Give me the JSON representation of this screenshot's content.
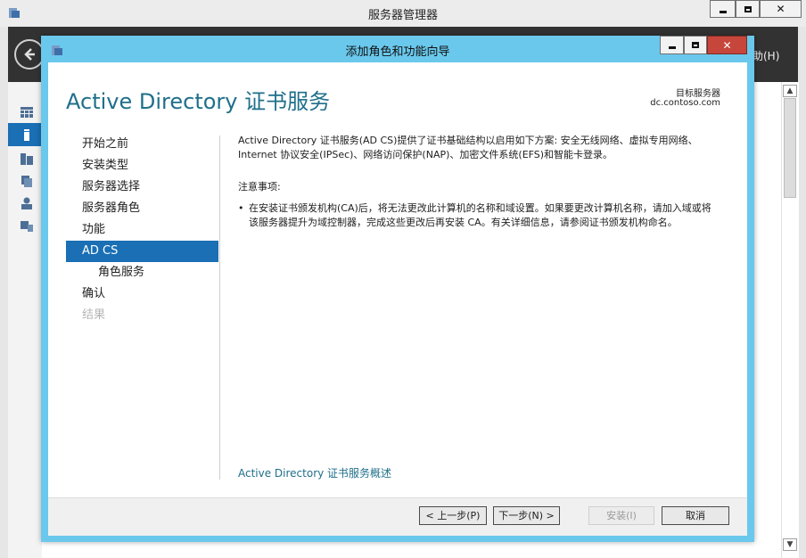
{
  "outer_window": {
    "title": "服务器管理器",
    "help_menu": "助(H)"
  },
  "dialog": {
    "title": "添加角色和功能向导",
    "page_title": "Active Directory 证书服务",
    "target_server_label": "目标服务器",
    "target_server_value": "dc.contoso.com"
  },
  "nav": {
    "items": [
      {
        "label": "开始之前",
        "state": "normal"
      },
      {
        "label": "安装类型",
        "state": "normal"
      },
      {
        "label": "服务器选择",
        "state": "normal"
      },
      {
        "label": "服务器角色",
        "state": "normal"
      },
      {
        "label": "功能",
        "state": "normal"
      },
      {
        "label": "AD CS",
        "state": "active"
      },
      {
        "label": "角色服务",
        "state": "sub"
      },
      {
        "label": "确认",
        "state": "normal"
      },
      {
        "label": "结果",
        "state": "disabled"
      }
    ]
  },
  "content": {
    "description": "Active Directory 证书服务(AD CS)提供了证书基础结构以启用如下方案: 安全无线网络、虚拟专用网络、Internet 协议安全(IPSec)、网络访问保护(NAP)、加密文件系统(EFS)和智能卡登录。",
    "notes_heading": "注意事项:",
    "bullet": "在安装证书颁发机构(CA)后，将无法更改此计算机的名称和域设置。如果要更改计算机名称，请加入域或将该服务器提升为域控制器，完成这些更改后再安装 CA。有关详细信息，请参阅证书颁发机构命名。",
    "link": "Active Directory 证书服务概述"
  },
  "buttons": {
    "prev": "< 上一步(P)",
    "next": "下一步(N) >",
    "install": "安装(I)",
    "cancel": "取消"
  },
  "colors": {
    "accent": "#1a6fb5",
    "dialog_frame": "#6ac8ec",
    "title_text": "#1f6f8b",
    "close_button": "#c7463b"
  }
}
